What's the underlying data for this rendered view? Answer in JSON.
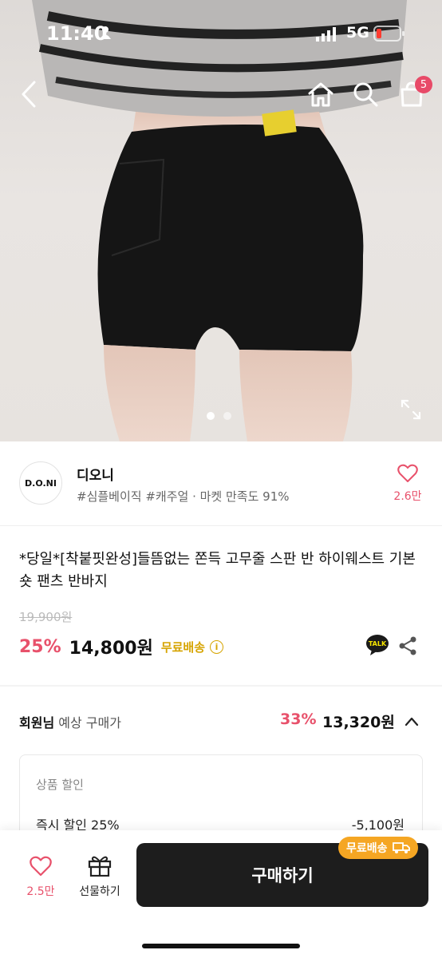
{
  "status_bar": {
    "time": "11:40",
    "network": "5G"
  },
  "header": {
    "cart_count": "5"
  },
  "gallery": {
    "total_images": 2,
    "active_index": 0
  },
  "seller": {
    "logo_text": "D.O.NI",
    "name": "디오니",
    "tags": "#심플베이직 #캐주얼 · 마켓 만족도 91%",
    "like_count": "2.6만"
  },
  "product": {
    "title": "*당일*[착붙핏완성]들뜸없는 쫀득 고무줄 스판 반 하이웨스트 기본 숏 팬츠 반바지",
    "original_price": "19,900원",
    "discount_rate": "25%",
    "price": "14,800원",
    "shipping": "무료배송",
    "talk_label": "TALK"
  },
  "member_price": {
    "label_bold": "회원님",
    "label_rest": " 예상 구매가",
    "discount_rate": "33%",
    "price": "13,320원"
  },
  "discount_detail": {
    "header": "상품 할인",
    "row_label": "즉시 할인 25%",
    "row_value": "-5,100원"
  },
  "bottom_bar": {
    "wish_count": "2.5만",
    "gift_label": "선물하기",
    "buy_label": "구매하기",
    "shipping_badge": "무료배송"
  },
  "colors": {
    "accent_pink": "#e8516b",
    "free_shipping_yellow": "#d6a400",
    "badge_orange": "#f5a623",
    "buy_button": "#1d1d1d"
  }
}
